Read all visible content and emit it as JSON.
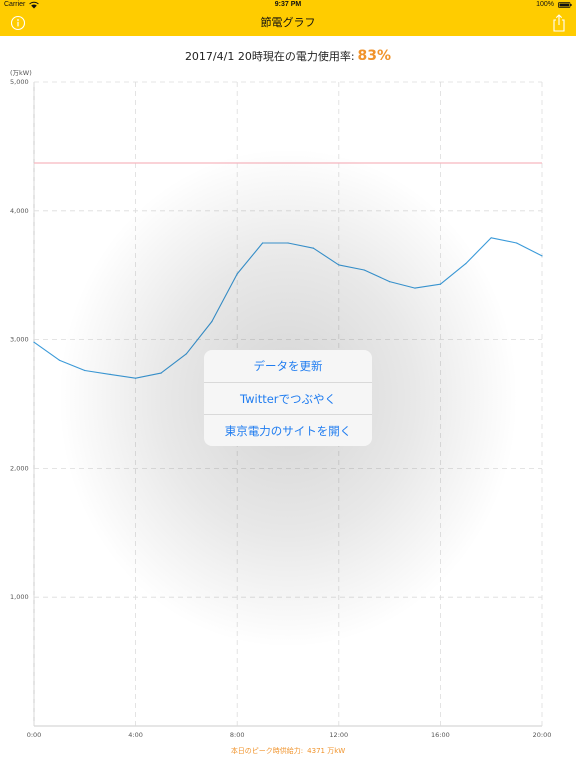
{
  "status_bar": {
    "carrier": "Carrier",
    "time": "9:37 PM",
    "battery": "100%",
    "icons": [
      "wifi-icon",
      "battery-icon"
    ]
  },
  "nav": {
    "title": "節電グラフ",
    "left_icon": "info-icon",
    "right_icon": "share-icon"
  },
  "headline": {
    "text": "2017/4/1 20時現在の電力使用率:",
    "rate": "83%"
  },
  "footer": {
    "label": "本日のピーク時供給力:",
    "value": "4371 万kW"
  },
  "menu": {
    "items": [
      "データを更新",
      "Twitterでつぶやく",
      "東京電力のサイトを開く"
    ]
  },
  "colors": {
    "accent": "#ffcc00",
    "rate": "#f0932b",
    "line": "#3a9ad9",
    "peak": "#f7b6bf",
    "menu_text": "#1f7cf0"
  },
  "chart_data": {
    "type": "line",
    "ylabel": "(万kW)",
    "x": [
      "0:00",
      "1:00",
      "2:00",
      "3:00",
      "4:00",
      "5:00",
      "6:00",
      "7:00",
      "8:00",
      "9:00",
      "10:00",
      "11:00",
      "12:00",
      "13:00",
      "14:00",
      "15:00",
      "16:00",
      "17:00",
      "18:00",
      "19:00",
      "20:00"
    ],
    "values": [
      2980,
      2840,
      2760,
      2730,
      2700,
      2740,
      2890,
      3140,
      3510,
      3750,
      3750,
      3710,
      3580,
      3540,
      3450,
      3400,
      3430,
      3590,
      3790,
      3750,
      3650
    ],
    "peak_supply": 4371,
    "ylim": [
      0,
      5000
    ],
    "yticks": [
      "1,000",
      "2,000",
      "3,000",
      "4,000",
      "5,000"
    ],
    "ytick_values": [
      1000,
      2000,
      3000,
      4000,
      5000
    ],
    "xticks": [
      "0:00",
      "4:00",
      "8:00",
      "12:00",
      "16:00",
      "20:00"
    ],
    "xtick_hours": [
      0,
      4,
      8,
      12,
      16,
      20
    ],
    "grid": true
  }
}
